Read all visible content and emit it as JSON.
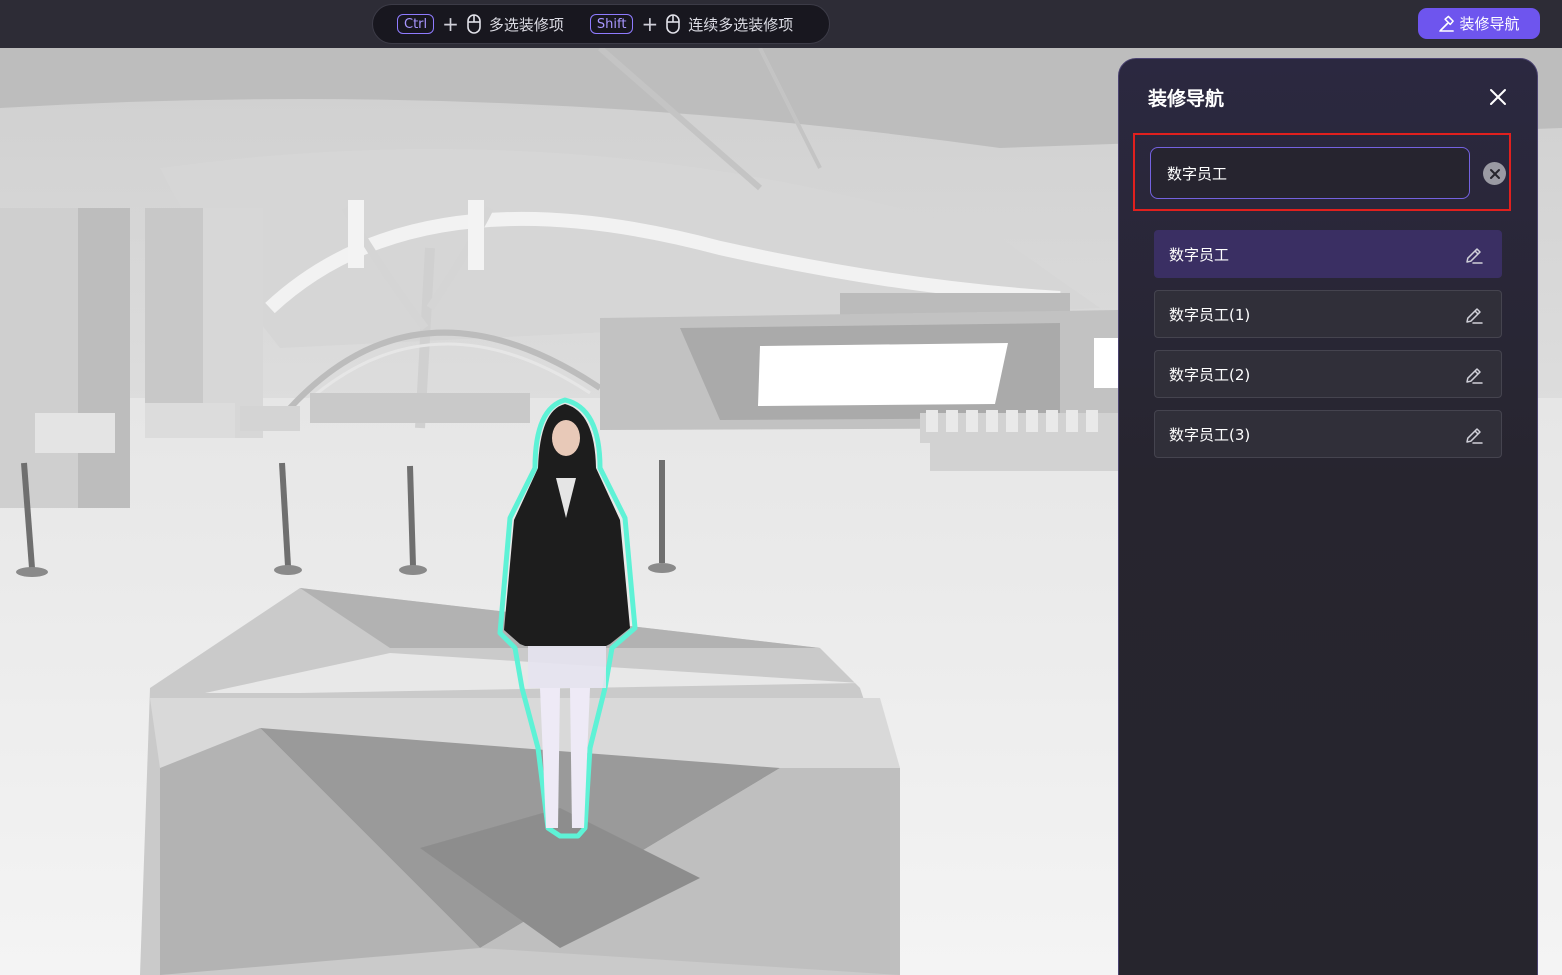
{
  "toolbar": {
    "hint1": {
      "key": "Ctrl",
      "plus": "+",
      "text": "多选装修项"
    },
    "hint2": {
      "key": "Shift",
      "plus": "+",
      "text": "连续多选装修项"
    },
    "nav_button_label": "装修导航"
  },
  "panel": {
    "title": "装修导航",
    "search_value": "数字员工",
    "results": [
      {
        "label": "数字员工",
        "active": true
      },
      {
        "label": "数字员工(1)",
        "active": false
      },
      {
        "label": "数字员工(2)",
        "active": false
      },
      {
        "label": "数字员工(3)",
        "active": false
      }
    ]
  },
  "colors": {
    "accent": "#6e55ee",
    "highlight_border": "#e0201e",
    "selection_outline": "#5ef2d6"
  }
}
